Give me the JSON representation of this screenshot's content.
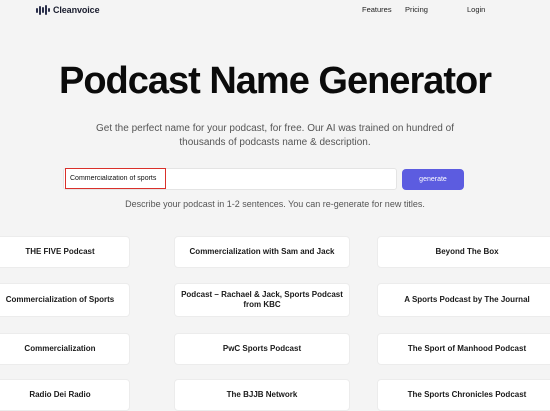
{
  "nav": {
    "logo_text": "Cleanvoice",
    "logo_icon": "waveform-icon",
    "links": [
      "Features",
      "Pricing",
      "Login"
    ]
  },
  "hero": {
    "title": "Podcast Name Generator",
    "subtitle": "Get the perfect name for your podcast, for free. Our AI was trained on hundred of thousands of podcasts name & description."
  },
  "form": {
    "input_value": "Commercialization of sports",
    "button_label": "generate",
    "hint": "Describe your podcast in 1-2 sentences. You can re-generate for new titles."
  },
  "results": [
    [
      "THE FIVE Podcast",
      "Commercialization with Sam and Jack",
      "Beyond The Box"
    ],
    [
      "Commercialization of Sports",
      "Podcast – Rachael & Jack, Sports Podcast from KBC",
      "A Sports Podcast by The Journal"
    ],
    [
      "Commercialization",
      "PwC Sports Podcast",
      "The Sport of Manhood Podcast"
    ],
    [
      "Radio Dei Radio",
      "The BJJB Network",
      "The Sports Chronicles Podcast"
    ]
  ],
  "colors": {
    "background": "#f4f4f4",
    "accent": "#5c5ce0",
    "highlight": "#d9302a"
  }
}
